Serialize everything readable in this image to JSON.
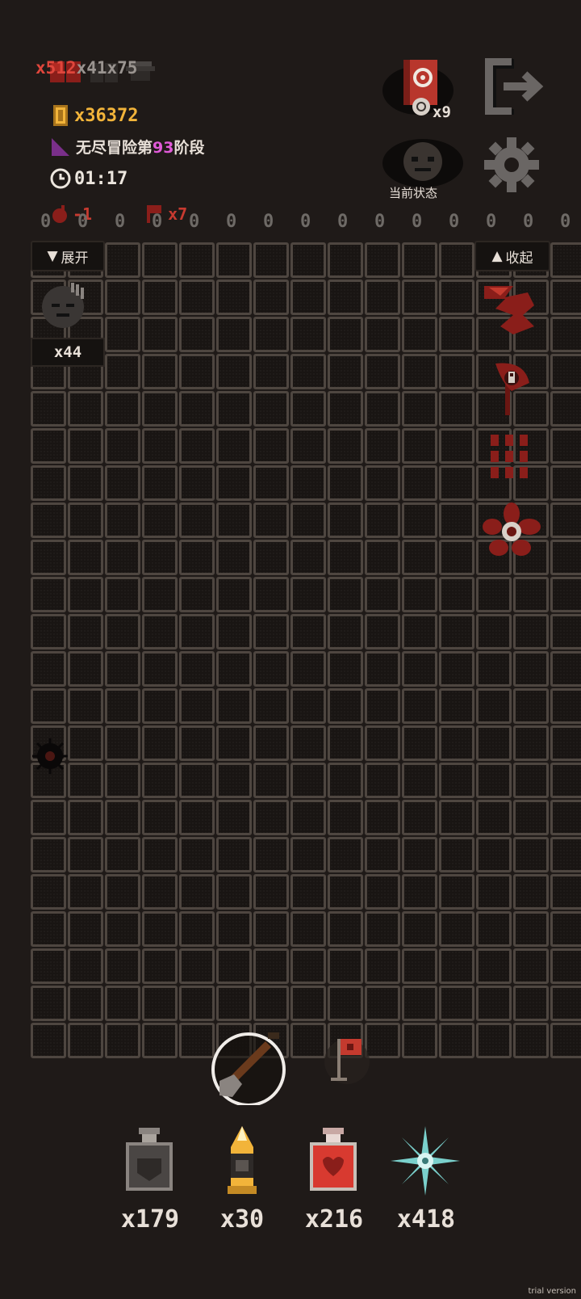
{
  "hud": {
    "resources": [
      {
        "name": "red-heart",
        "count": "x512",
        "color": "#e0463c"
      },
      {
        "name": "dark-heart",
        "count": "x41",
        "color": "#9a9490"
      },
      {
        "name": "armor",
        "count": "x75",
        "color": "#9a9490"
      }
    ],
    "gold": "x36372",
    "stage_prefix": "无尽冒险第",
    "stage_number": "93",
    "stage_suffix": "阶段",
    "timer": "01:17",
    "bombs": "-1",
    "flags": "x7",
    "spell_book_count": "x9",
    "current_status_label": "当前状态",
    "zero_strip": [
      "0",
      "0",
      "0",
      "0",
      "0",
      "0",
      "0",
      "0",
      "0",
      "0",
      "0",
      "0",
      "0",
      "0",
      "0"
    ]
  },
  "board": {
    "expand_label": "展开",
    "collapse_label": "收起",
    "monster_count": "x44"
  },
  "consumables": [
    {
      "icon": "gray-potion-icon",
      "count": "x179"
    },
    {
      "icon": "bullet-icon",
      "count": "x30"
    },
    {
      "icon": "red-potion-icon",
      "count": "x216"
    },
    {
      "icon": "ice-crystal-icon",
      "count": "x418"
    }
  ],
  "watermark": "trial version"
}
